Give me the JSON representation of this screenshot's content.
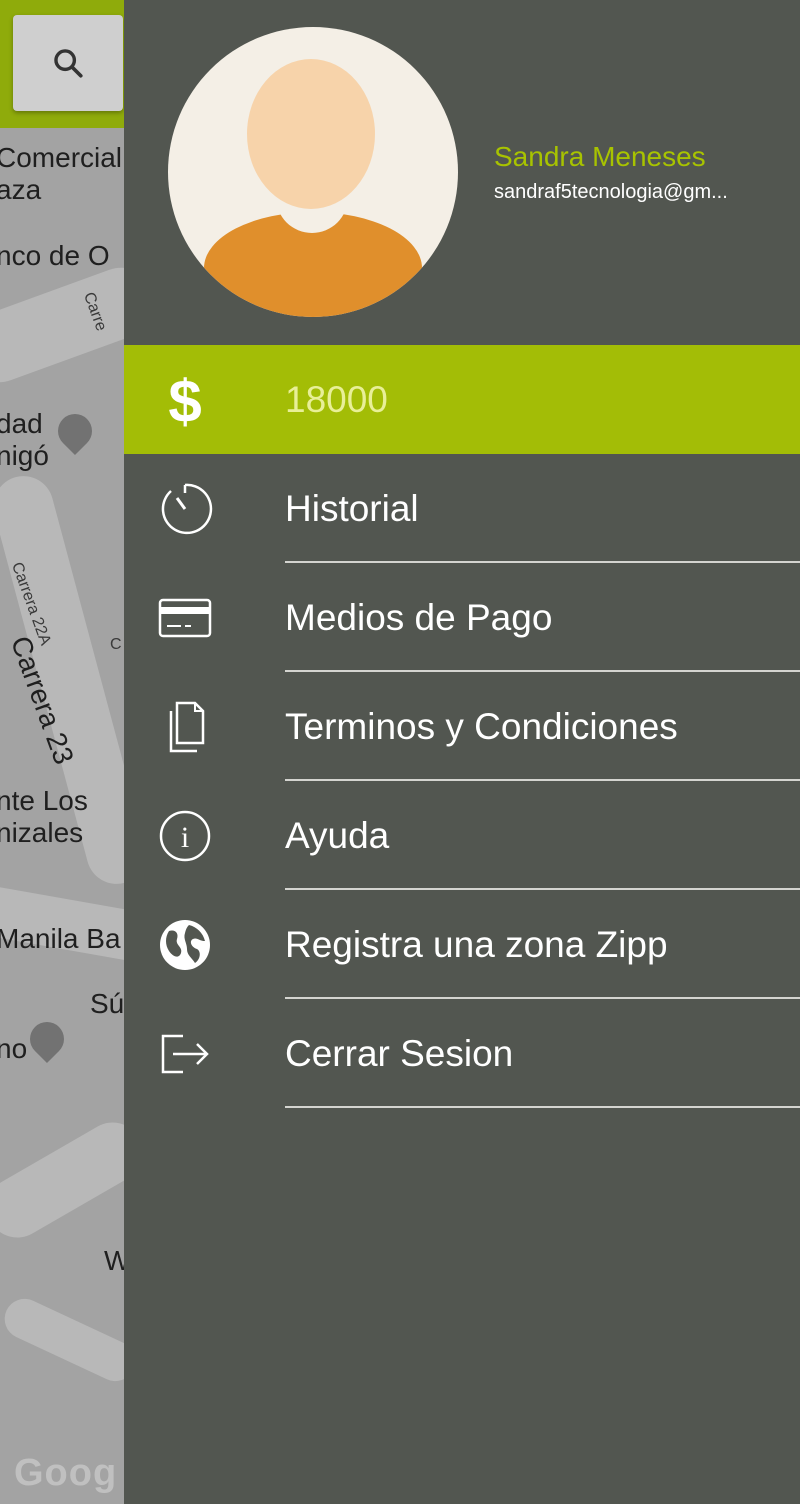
{
  "map": {
    "labels": [
      "Comercial",
      "aza",
      "nco de O",
      "Carre",
      "dad",
      "nigó",
      "Carrera 22A",
      "C",
      "Carrera 23",
      "nte Los",
      "nizales",
      "Manila Ba",
      "Sú",
      "no",
      "W"
    ],
    "google_logo": "Goog"
  },
  "search": {
    "icon": "search-icon"
  },
  "user": {
    "name": "Sandra Meneses",
    "email": "sandraf5tecnologia@gm..."
  },
  "menu": {
    "items": [
      {
        "label": "18000",
        "icon": "dollar-icon",
        "active": true
      },
      {
        "label": "Historial",
        "icon": "clock-icon"
      },
      {
        "label": "Medios de Pago",
        "icon": "credit-card-icon"
      },
      {
        "label": "Terminos y Condiciones",
        "icon": "documents-icon"
      },
      {
        "label": "Ayuda",
        "icon": "info-icon"
      },
      {
        "label": "Registra una zona Zipp",
        "icon": "globe-icon"
      },
      {
        "label": "Cerrar Sesion",
        "icon": "logout-icon"
      }
    ]
  },
  "colors": {
    "drawer_bg": "#525650",
    "accent_green": "#a3bd06",
    "user_name": "#a8c300",
    "avatar_body": "#e08f2c",
    "avatar_head": "#f7d3aa"
  }
}
